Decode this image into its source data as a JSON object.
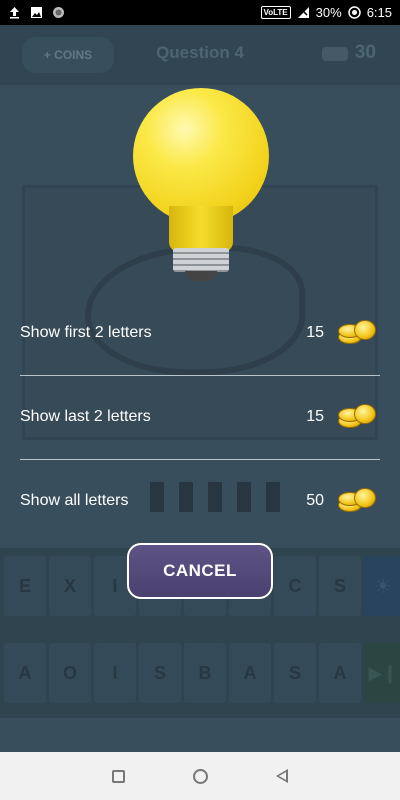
{
  "status_bar": {
    "icons_left": [
      "upload-icon",
      "image-icon",
      "circle-icon"
    ],
    "volte": "VoLTE",
    "battery": "30%",
    "time": "6:15"
  },
  "game": {
    "coins_button": "+ COINS",
    "question_title": "Question 4",
    "coin_count": "30",
    "keyboard": {
      "row1": [
        "E",
        "X",
        "I",
        "",
        "",
        "",
        "C",
        "S"
      ],
      "row2": [
        "A",
        "O",
        "I",
        "S",
        "B",
        "A",
        "S",
        "A"
      ]
    }
  },
  "hint_dialog": {
    "options": [
      {
        "label": "Show first 2 letters",
        "cost": "15"
      },
      {
        "label": "Show last 2 letters",
        "cost": "15"
      },
      {
        "label": "Show all letters",
        "cost": "50"
      }
    ],
    "cancel_label": "CANCEL"
  }
}
